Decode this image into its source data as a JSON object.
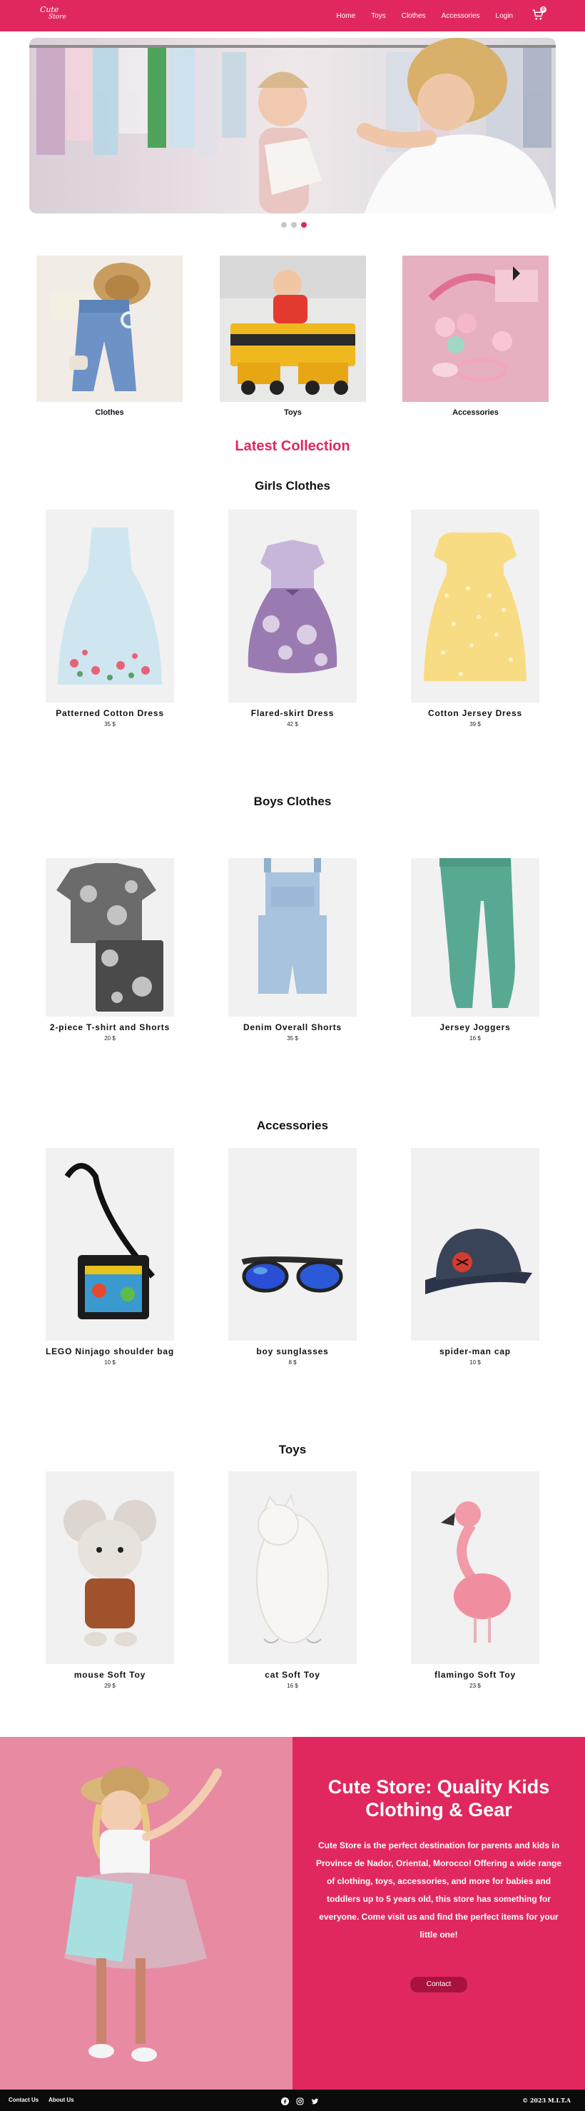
{
  "nav": {
    "logo_line1": "Cute",
    "logo_line2": "Store",
    "links": [
      "Home",
      "Toys",
      "Clothes",
      "Accessories",
      "Login"
    ],
    "cart_count": "0"
  },
  "hero": {
    "slides": 3,
    "active_slide": 3
  },
  "categories": [
    {
      "label": "Clothes",
      "icon": "clothes-image"
    },
    {
      "label": "Toys",
      "icon": "toy-truck-image"
    },
    {
      "label": "Accessories",
      "icon": "hair-accessories-image"
    }
  ],
  "latest_title": "Latest Collection",
  "sections": [
    {
      "title": "Girls Clothes",
      "products": [
        {
          "name": "Patterned Cotton Dress",
          "price": "35 $"
        },
        {
          "name": "Flared-skirt Dress",
          "price": "42 $"
        },
        {
          "name": "Cotton Jersey Dress",
          "price": "39 $"
        }
      ]
    },
    {
      "title": "Boys Clothes",
      "products": [
        {
          "name": "2-piece T-shirt and Shorts",
          "price": "20 $"
        },
        {
          "name": "Denim Overall Shorts",
          "price": "35 $"
        },
        {
          "name": "Jersey Joggers",
          "price": "16 $"
        }
      ]
    },
    {
      "title": "Accessories",
      "products": [
        {
          "name": "LEGO Ninjago shoulder bag",
          "price": "10 $"
        },
        {
          "name": "boy sunglasses",
          "price": "8 $"
        },
        {
          "name": "spider-man cap",
          "price": "10 $"
        }
      ]
    },
    {
      "title": "Toys",
      "products": [
        {
          "name": "mouse Soft Toy",
          "price": "29 $"
        },
        {
          "name": "cat Soft Toy",
          "price": "16 $"
        },
        {
          "name": "flamingo Soft Toy",
          "price": "23 $"
        }
      ]
    }
  ],
  "promo": {
    "title": "Cute Store: Quality Kids Clothing & Gear",
    "text": "Cute Store is the perfect destination for parents and kids in Province de Nador, Oriental, Morocco! Offering a wide range of clothing, toys, accessories, and more for babies and toddlers up to 5 years old, this store has something for everyone. Come visit us and find the perfect items for your little one!",
    "button": "Contact"
  },
  "footer": {
    "links": [
      "Contact Us",
      "About Us"
    ],
    "social": [
      "facebook-icon",
      "instagram-icon",
      "twitter-icon"
    ],
    "copyright": "© 2023 M.I.T.A"
  },
  "colors": {
    "brand": "#e0285f",
    "button": "#a8123f",
    "footer": "#0b0b0b"
  }
}
